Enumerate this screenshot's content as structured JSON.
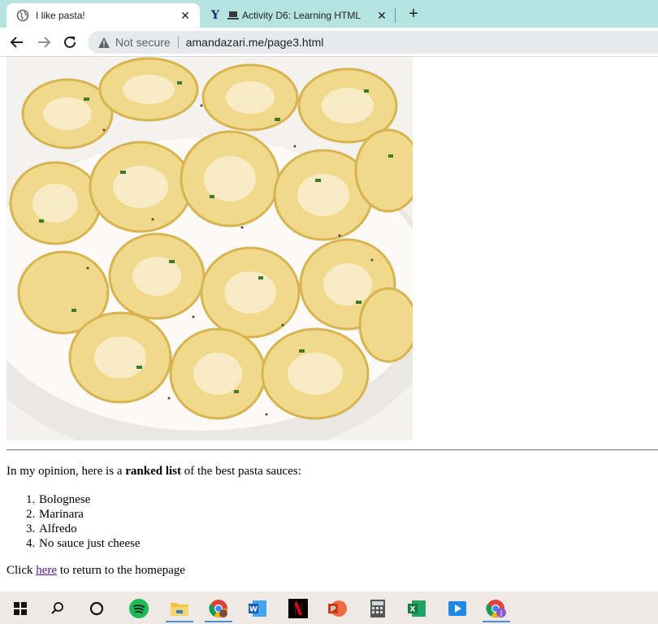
{
  "browser": {
    "tabs": [
      {
        "title": "I like pasta!",
        "icon": "globe-icon",
        "active": true
      },
      {
        "title": "Activity D6: Learning HTML",
        "icon": "y-icon",
        "active": false
      }
    ],
    "security_label": "Not secure",
    "url": "amandazari.me/page3.html"
  },
  "page": {
    "image_alt": "pasta-photo",
    "intro_before": "In my opinion, here is a ",
    "intro_bold": "ranked list",
    "intro_after": " of the best pasta sauces:",
    "sauces": [
      "Bolognese",
      "Marinara",
      "Alfredo",
      "No sauce just cheese"
    ],
    "return_before": "Click ",
    "return_link": "here",
    "return_after": " to return to the homepage"
  },
  "taskbar": {
    "apps": [
      "windows-start",
      "search",
      "cortana",
      "spotify",
      "file-explorer",
      "chrome",
      "word",
      "netflix",
      "powerpoint",
      "calculator",
      "excel",
      "video-player",
      "chrome-profile"
    ]
  },
  "colors": {
    "tabstrip": "#b5e3e0",
    "visited_link": "#551a8b",
    "taskbar": "#efe9e6"
  }
}
